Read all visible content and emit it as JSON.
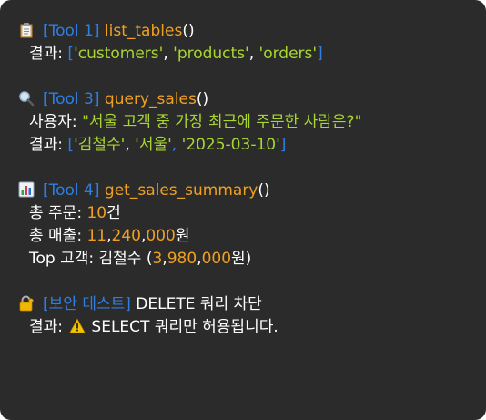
{
  "colors": {
    "background": "#2b2b2b",
    "tag": "#2e7fe0",
    "function": "#f0a020",
    "string": "#a8d530",
    "number": "#f0a020",
    "text": "#ffffff"
  },
  "block1": {
    "icon": "clipboard-icon",
    "tag": "[Tool 1]",
    "func": "list_tables",
    "parens": "()",
    "result_label": "결과: ",
    "open_bracket": "[",
    "items": [
      "'customers'",
      "'products'",
      "'orders'"
    ],
    "sep": ", ",
    "close_bracket": "]"
  },
  "block2": {
    "icon": "magnifier-icon",
    "tag": "[Tool 3]",
    "func": "query_sales",
    "parens": "()",
    "user_label": "사용자: ",
    "query": "\"서울 고객 중 가장 최근에 주문한 사람은?\"",
    "result_label": "결과: ",
    "open_bracket": "[",
    "items": [
      "'김철수'",
      "'서울'",
      "'2025-03-10'"
    ],
    "sep": ", ",
    "close_bracket": "]"
  },
  "block3": {
    "icon": "bar-chart-icon",
    "tag": "[Tool 4]",
    "func": "get_sales_summary",
    "parens": "()",
    "orders_label": "총 주문: ",
    "orders_value": "10",
    "orders_unit": "건",
    "sales_label": "총 매출: ",
    "sales_part1": "11",
    "sales_part2": "240",
    "sales_part3": "000",
    "comma": ",",
    "sales_unit": "원",
    "top_label": "Top 고객: 김철수 (",
    "top_part1": "3",
    "top_part2": "980",
    "top_part3": "000",
    "top_unit": "원)"
  },
  "block4": {
    "icon": "lock-key-icon",
    "tag": "[보안 테스트]",
    "title": "DELETE 쿼리 차단",
    "result_label": "결과: ",
    "warning_icon": "warning-icon",
    "message": "SELECT 쿼리만 허용됩니다."
  }
}
